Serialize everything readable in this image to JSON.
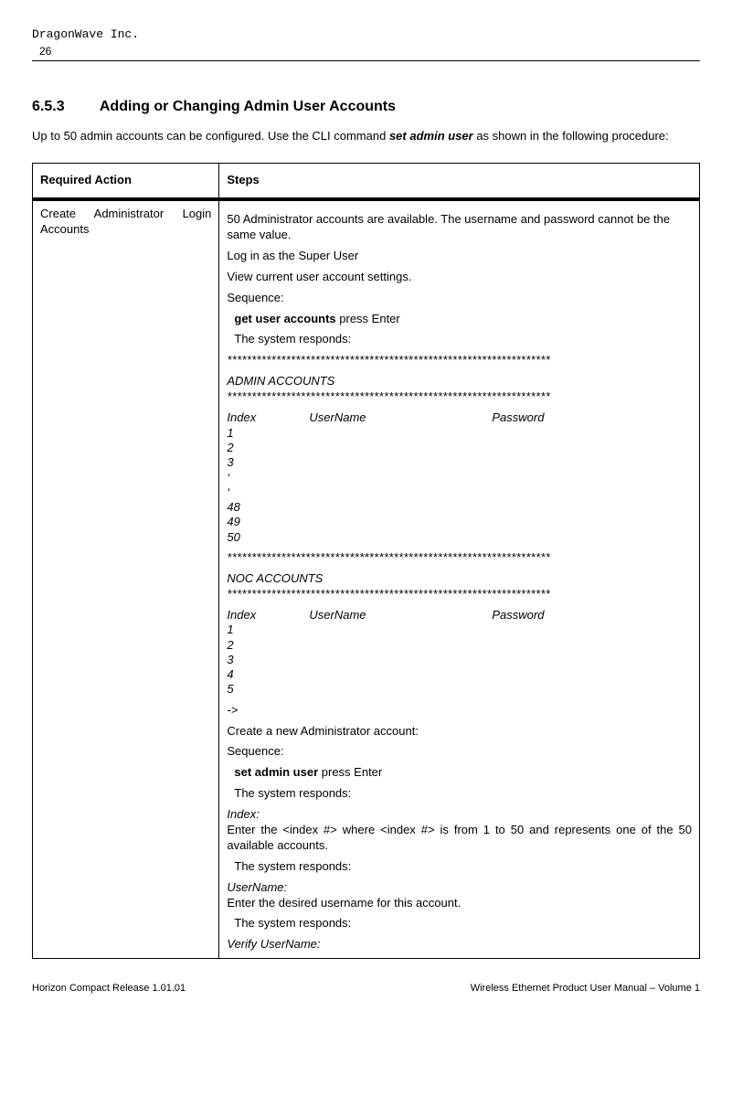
{
  "header": {
    "company": "DragonWave Inc.",
    "page_number": "26"
  },
  "section": {
    "number": "6.5.3",
    "title": "Adding or Changing Admin User Accounts"
  },
  "intro": {
    "text_before": "Up to 50 admin accounts can be configured. Use the CLI command ",
    "command": "set admin user",
    "text_after": " as shown in the following procedure:"
  },
  "table": {
    "header_action": "Required Action",
    "header_steps": "Steps",
    "action_cell": "Create Administrator Login Accounts",
    "steps": {
      "avail": "50 Administrator accounts are available.  The username and password cannot be the same value.",
      "login": "Log in as the Super User",
      "view": "View current user account settings.",
      "sequence_label": "Sequence:",
      "cmd1_bold": "get user accounts",
      "cmd1_rest": " press Enter",
      "resp_label": "The system responds:",
      "stars": "******************************************************************",
      "admin_hdr": "ADMIN ACCOUNTS",
      "col_index": "Index",
      "col_user": "UserName",
      "col_pass": "Password",
      "r1": "1",
      "r2": "2",
      "r3": "3",
      "dot1": "‘",
      "dot2": "‘",
      "r48": "48",
      "r49": "49",
      "r50": "50",
      "noc_hdr": "NOC ACCOUNTS",
      "n1": "1",
      "n2": "2",
      "n3": "3",
      "n4": "4",
      "n5": "5",
      "prompt": "->",
      "create": "Create a new Administrator account:",
      "cmd2_bold": "set admin user",
      "cmd2_rest": " press Enter",
      "idx_label": "Index:",
      "idx_text": "Enter the <index #> where <index #> is from 1 to 50 and represents one of the 50 available accounts.",
      "user_label": "UserName:",
      "user_text": "Enter the desired username for this account.",
      "verify_label": "Verify UserName:"
    }
  },
  "footer": {
    "left": "Horizon Compact Release 1.01.01",
    "right": "Wireless Ethernet Product User Manual – Volume 1"
  }
}
